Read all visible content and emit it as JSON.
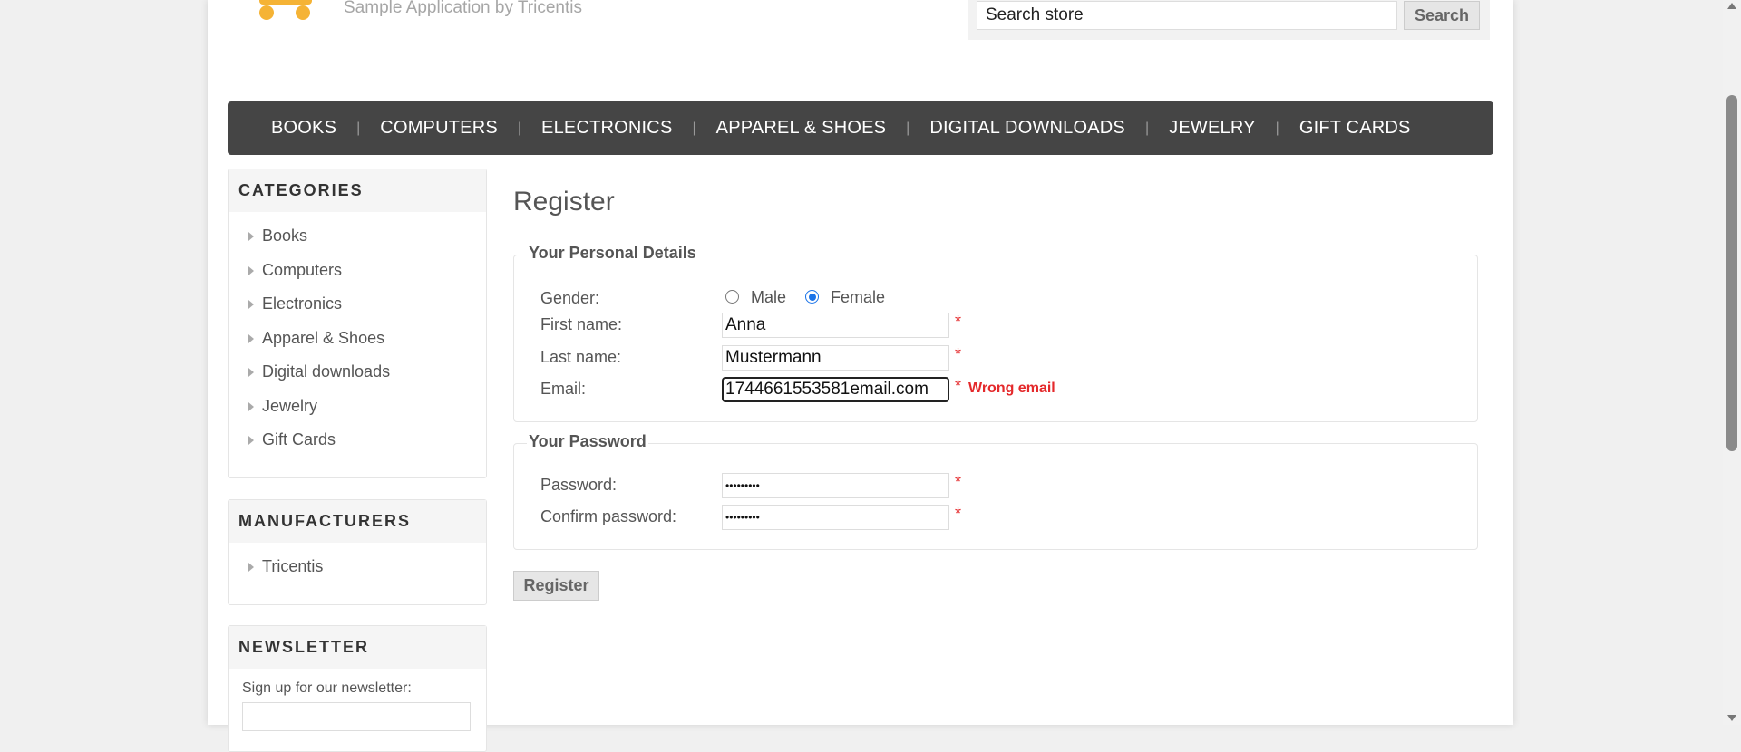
{
  "header": {
    "tagline": "Sample Application by Tricentis",
    "logo_icon": "skateboard-logo-icon",
    "search": {
      "value": "Search store",
      "button_label": "Search"
    }
  },
  "top_menu": {
    "items": [
      {
        "label": "BOOKS"
      },
      {
        "label": "COMPUTERS"
      },
      {
        "label": "ELECTRONICS"
      },
      {
        "label": "APPAREL & SHOES"
      },
      {
        "label": "DIGITAL DOWNLOADS"
      },
      {
        "label": "JEWELRY"
      },
      {
        "label": "GIFT CARDS"
      }
    ],
    "separator": "|"
  },
  "sidebar": {
    "categories": {
      "title": "CATEGORIES",
      "items": [
        {
          "label": "Books"
        },
        {
          "label": "Computers"
        },
        {
          "label": "Electronics"
        },
        {
          "label": "Apparel & Shoes"
        },
        {
          "label": "Digital downloads"
        },
        {
          "label": "Jewelry"
        },
        {
          "label": "Gift Cards"
        }
      ]
    },
    "manufacturers": {
      "title": "MANUFACTURERS",
      "items": [
        {
          "label": "Tricentis"
        }
      ]
    },
    "newsletter": {
      "title": "NEWSLETTER",
      "label": "Sign up for our newsletter:",
      "input_value": ""
    }
  },
  "main": {
    "title": "Register",
    "personal": {
      "legend": "Your Personal Details",
      "gender_label": "Gender:",
      "male_label": "Male",
      "female_label": "Female",
      "gender_selected": "Female",
      "first_name_label": "First name:",
      "first_name_value": "Anna",
      "last_name_label": "Last name:",
      "last_name_value": "Mustermann",
      "email_label": "Email:",
      "email_value": "1744661553581email.com",
      "email_error": "Wrong email"
    },
    "password": {
      "legend": "Your Password",
      "password_label": "Password:",
      "password_value": "•••••••••",
      "confirm_label": "Confirm password:",
      "confirm_value": "•••••••••"
    },
    "required_marker": "*",
    "register_label": "Register"
  },
  "colors": {
    "menu_bg": "#454545",
    "error": "#e4292b",
    "radio_selected": "#1a73e8",
    "logo": "#f5b335"
  }
}
